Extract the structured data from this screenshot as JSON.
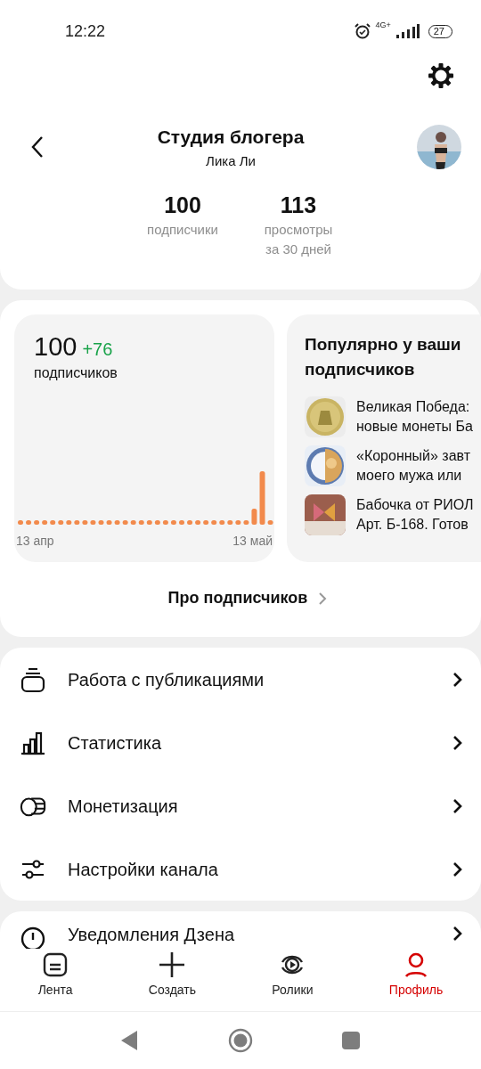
{
  "status_bar": {
    "time": "12:22",
    "network": "4G+",
    "battery": "27"
  },
  "header": {
    "title": "Студия блогера",
    "subtitle": "Лика Ли"
  },
  "stats": [
    {
      "value": "100",
      "label": "подписчики"
    },
    {
      "value": "113",
      "label": "просмотры за 30 дней"
    }
  ],
  "subscribers_card": {
    "count": "100",
    "delta": "+76",
    "label": "подписчиков",
    "x_start": "13 апр",
    "x_end": "13 май"
  },
  "popular_card": {
    "title": "Популярно у ваши\nподписчиков",
    "items": [
      {
        "line1": "Великая Победа:",
        "line2": "новые монеты Ба"
      },
      {
        "line1": "«Коронный» завт",
        "line2": "моего мужа или"
      },
      {
        "line1": "Бабочка от РИОЛ",
        "line2": "Арт. Б-168. Готов"
      }
    ]
  },
  "about_link": "Про подписчиков",
  "menu": [
    {
      "kind": "publications",
      "label": "Работа с публикациями"
    },
    {
      "kind": "stats",
      "label": "Статистика"
    },
    {
      "kind": "money",
      "label": "Монетизация"
    },
    {
      "kind": "settings",
      "label": "Настройки канала"
    }
  ],
  "menu_2": [
    {
      "kind": "notifications",
      "label": "Уведомления Дзена"
    }
  ],
  "bottom_nav": [
    {
      "kind": "feed",
      "label": "Лента",
      "selected": false
    },
    {
      "kind": "create",
      "label": "Создать",
      "selected": false
    },
    {
      "kind": "clips",
      "label": "Ролики",
      "selected": false
    },
    {
      "kind": "profile",
      "label": "Профиль",
      "selected": true
    }
  ]
}
